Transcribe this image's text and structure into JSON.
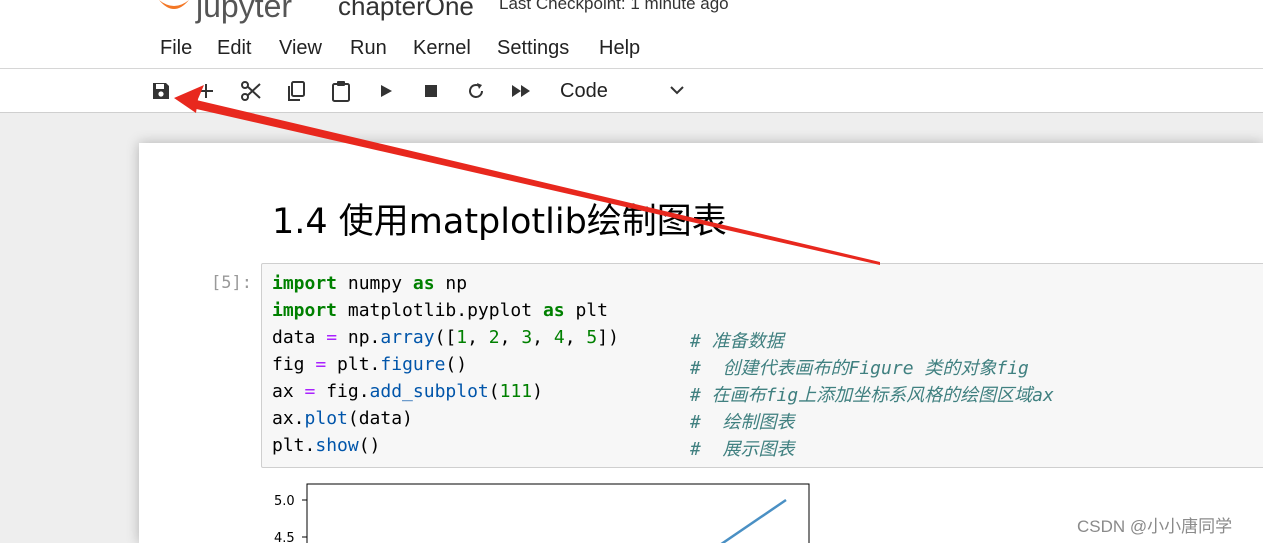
{
  "header": {
    "logo_text": "jupyter",
    "notebook_title": "chapterOne",
    "checkpoint": "Last Checkpoint: 1 minute ago"
  },
  "menu": {
    "items": [
      {
        "label": "File"
      },
      {
        "label": "Edit"
      },
      {
        "label": "View"
      },
      {
        "label": "Run"
      },
      {
        "label": "Kernel"
      },
      {
        "label": "Settings"
      },
      {
        "label": "Help"
      }
    ]
  },
  "toolbar": {
    "buttons": [
      "save-icon",
      "add-cell-icon",
      "cut-icon",
      "copy-icon",
      "paste-icon",
      "run-icon",
      "stop-icon",
      "restart-icon",
      "run-all-icon"
    ],
    "cell_type": "Code"
  },
  "notebook": {
    "heading": "1.4 使用matplotlib绘制图表",
    "prompt": "[5]:",
    "code": [
      {
        "text": "import numpy as np",
        "comment": ""
      },
      {
        "text": "import matplotlib.pyplot as plt",
        "comment": ""
      },
      {
        "text": "data = np.array([1, 2, 3, 4, 5])",
        "comment": "# 准备数据"
      },
      {
        "text": "fig = plt.figure()",
        "comment": "#  创建代表画布的Figure 类的对象fig"
      },
      {
        "text": "ax = fig.add_subplot(111)",
        "comment": "# 在画布fig上添加坐标系风格的绘图区域ax"
      },
      {
        "text": "ax.plot(data)",
        "comment": "#  绘制图表"
      },
      {
        "text": "plt.show()",
        "comment": "#  展示图表"
      }
    ],
    "plot_ticks": [
      "5.0",
      "4.5"
    ]
  },
  "colors": {
    "annotation_arrow": "#e8281e",
    "plot_line": "#4a90c4"
  },
  "watermark": "CSDN @小小唐同学"
}
